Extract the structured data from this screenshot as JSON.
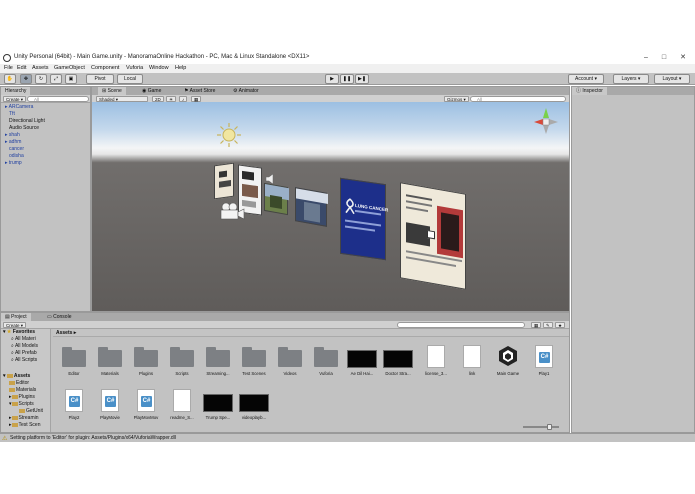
{
  "window": {
    "title": "Unity Personal (64bit) - Main Game.unity - ManoramaOnline Hackathon - PC, Mac & Linux Standalone <DX11>",
    "minimize": "–",
    "maximize": "□",
    "close": "✕"
  },
  "menu": [
    "File",
    "Edit",
    "Assets",
    "GameObject",
    "Component",
    "Vuforia",
    "Window",
    "Help"
  ],
  "toolbar": {
    "pivot": "Pivot",
    "local": "Local",
    "account": "Account",
    "layers": "Layers",
    "layout": "Layout"
  },
  "hierarchy": {
    "tab": "Hierarchy",
    "create": "Create",
    "search_placeholder": "All",
    "items": [
      "ARCamera",
      "Tft",
      "Directional Light",
      "Audio Source",
      "shah",
      "adhm",
      "cancer",
      "odisha",
      "trump"
    ]
  },
  "scene": {
    "tabs": [
      "Scene",
      "Game",
      "Asset Store",
      "Animator"
    ],
    "shading": "Shaded",
    "mode2d": "2D",
    "gizmos": "Gizmos",
    "search_placeholder": "All",
    "poster_title": "LUNG CANCER"
  },
  "inspector": {
    "tab": "Inspector"
  },
  "project": {
    "tabs": [
      "Project",
      "Console"
    ],
    "create": "Create",
    "breadcrumb": "Assets",
    "tree": [
      {
        "label": "Favorites",
        "level": 0
      },
      {
        "label": "All Materi",
        "level": 1
      },
      {
        "label": "All Models",
        "level": 1
      },
      {
        "label": "All Prefab",
        "level": 1
      },
      {
        "label": "All Scripts",
        "level": 1
      },
      {
        "label": "Assets",
        "level": 0
      },
      {
        "label": "Editor",
        "level": 1
      },
      {
        "label": "Materials",
        "level": 1
      },
      {
        "label": "Plugins",
        "level": 1
      },
      {
        "label": "Scripts",
        "level": 1
      },
      {
        "label": "GetUnit",
        "level": 2
      },
      {
        "label": "Streamin",
        "level": 1
      },
      {
        "label": "Test Scen",
        "level": 1
      }
    ],
    "assets": [
      {
        "label": "Editor",
        "kind": "folder"
      },
      {
        "label": "Materials",
        "kind": "folder"
      },
      {
        "label": "Plugins",
        "kind": "folder"
      },
      {
        "label": "Scripts",
        "kind": "folder"
      },
      {
        "label": "Streaming...",
        "kind": "folder"
      },
      {
        "label": "Test Scenes",
        "kind": "folder"
      },
      {
        "label": "Videos",
        "kind": "folder"
      },
      {
        "label": "Vuforia",
        "kind": "folder"
      },
      {
        "label": "Ae Dil Hai...",
        "kind": "video"
      },
      {
        "label": "Doctor Stra...",
        "kind": "video"
      },
      {
        "label": "license_3...",
        "kind": "doc"
      },
      {
        "label": "link",
        "kind": "doc"
      },
      {
        "label": "Main Game",
        "kind": "unity"
      },
      {
        "label": "Play1",
        "kind": "cs"
      },
      {
        "label": "Play2",
        "kind": "cs"
      },
      {
        "label": "PlayMovie",
        "kind": "cs"
      },
      {
        "label": "PlayMovMov",
        "kind": "cs"
      },
      {
        "label": "readme_S...",
        "kind": "doc"
      },
      {
        "label": "Trump Spe...",
        "kind": "video"
      },
      {
        "label": "videoplayb...",
        "kind": "video"
      }
    ]
  },
  "status": "Setting platform to 'Editor' for plugin: Assets/Plugins/x64/VuforiaWrapper.dll",
  "colors": {
    "panel": "#c2c2c2",
    "hierarchy_text": "#1f3fa0",
    "cs_icon": "#4a90c8"
  }
}
